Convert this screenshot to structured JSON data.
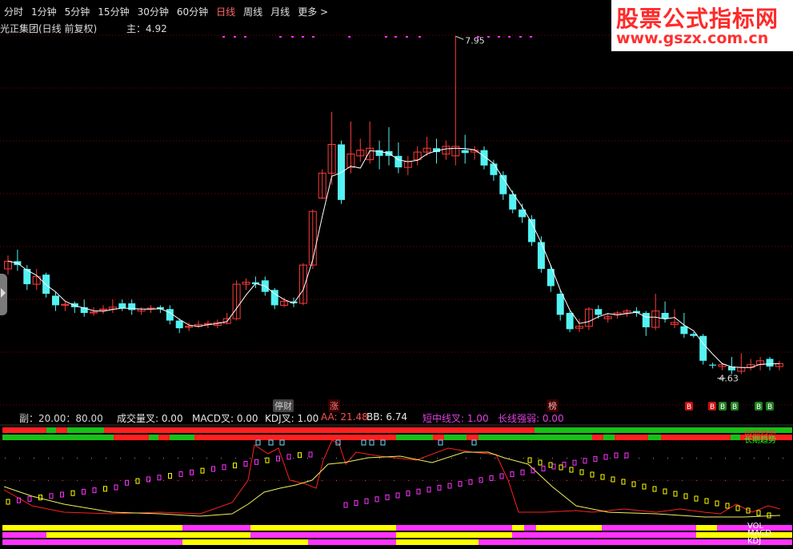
{
  "toolbar": {
    "tabs": [
      "分时",
      "1分钟",
      "5分钟",
      "15分钟",
      "30分钟",
      "60分钟",
      "日线",
      "周线",
      "月线",
      "更多 >"
    ],
    "active": "日线"
  },
  "stock": {
    "title": "光正集团(日线 前复权)",
    "main_label": "主：4.92"
  },
  "brand": {
    "title": "股票公式指标网",
    "url": "www.gszx.com.cn"
  },
  "annotations": {
    "high": "7.95",
    "low": "4.63"
  },
  "event_tags": [
    {
      "text": "停财",
      "color": "#cfcfcf",
      "bg": "#444"
    },
    {
      "text": "涨",
      "color": "#ff8080",
      "bg": "#3a0000"
    },
    {
      "text": "榜",
      "color": "#ffb0b0",
      "bg": "#3a0000"
    }
  ],
  "bottom_markers": [
    "B",
    "B",
    "B",
    "B",
    "B",
    "B"
  ],
  "indicator_bar": {
    "sub": "副：20.00：80.00",
    "vol_cross": "成交量叉: 0.00",
    "macd_cross": "MACD叉: 0.00",
    "kdj_cross": "KDJ叉: 1.00",
    "aa": "AA: 21.48",
    "bb": "BB: 6.74",
    "mid_cross": "短中线叉: 1.00",
    "long_strength": "长线强弱: 0.00"
  },
  "strip_labels": {
    "top1": "中期趋势",
    "top2": "长期趋势",
    "vol": "VOL",
    "macd": "MACD",
    "kdj": "KDJ"
  },
  "colors": {
    "up": "#ff3b3b",
    "down": "#54f2f2",
    "ma": "#ffffff",
    "grid": "#8a0000",
    "green": "#18c018",
    "red": "#ff2020",
    "yellow": "#ffff00",
    "magenta": "#ff33ff",
    "line_red": "#ff2020",
    "line_yellow": "#f0f060"
  },
  "chart_data": {
    "type": "candlestick",
    "candles": [
      [
        5.52,
        5.6,
        5.66,
        5.46
      ],
      [
        5.6,
        5.56,
        5.72,
        5.5
      ],
      [
        5.52,
        5.36,
        5.56,
        5.3
      ],
      [
        5.36,
        5.44,
        5.52,
        5.3
      ],
      [
        5.46,
        5.26,
        5.48,
        5.22
      ],
      [
        5.24,
        5.14,
        5.28,
        5.08
      ],
      [
        5.14,
        5.15,
        5.18,
        5.08
      ],
      [
        5.16,
        5.12,
        5.18,
        5.06
      ],
      [
        5.12,
        5.06,
        5.2,
        5.02
      ],
      [
        5.06,
        5.07,
        5.12,
        5.03
      ],
      [
        5.09,
        5.1,
        5.14,
        5.05
      ],
      [
        5.1,
        5.12,
        5.2,
        5.06
      ],
      [
        5.16,
        5.11,
        5.2,
        5.08
      ],
      [
        5.16,
        5.09,
        5.2,
        5.04
      ],
      [
        5.08,
        5.1,
        5.12,
        5.04
      ],
      [
        5.1,
        5.11,
        5.14,
        5.06
      ],
      [
        5.12,
        5.1,
        5.14,
        5.06
      ],
      [
        5.1,
        4.98,
        5.14,
        4.94
      ],
      [
        4.98,
        4.9,
        5.0,
        4.85
      ],
      [
        4.91,
        4.92,
        4.96,
        4.87
      ],
      [
        4.92,
        4.94,
        4.98,
        4.9
      ],
      [
        4.94,
        4.95,
        4.98,
        4.9
      ],
      [
        4.93,
        4.96,
        4.99,
        4.9
      ],
      [
        4.95,
        5.0,
        5.06,
        4.94
      ],
      [
        5.0,
        5.36,
        5.4,
        4.98
      ],
      [
        5.36,
        5.38,
        5.42,
        5.3
      ],
      [
        5.38,
        5.36,
        5.44,
        5.32
      ],
      [
        5.4,
        5.28,
        5.44,
        5.24
      ],
      [
        5.3,
        5.14,
        5.32,
        5.1
      ],
      [
        5.14,
        5.18,
        5.22,
        5.12
      ],
      [
        5.18,
        5.16,
        5.22,
        5.12
      ],
      [
        5.16,
        5.56,
        5.58,
        5.14
      ],
      [
        5.56,
        6.12,
        6.14,
        5.52
      ],
      [
        6.26,
        6.52,
        6.56,
        6.25
      ],
      [
        6.52,
        6.82,
        7.16,
        6.4
      ],
      [
        6.82,
        6.24,
        6.86,
        6.2
      ],
      [
        6.58,
        6.72,
        7.06,
        6.52
      ],
      [
        6.7,
        6.76,
        6.88,
        6.64
      ],
      [
        6.66,
        6.78,
        7.06,
        6.62
      ],
      [
        6.76,
        6.7,
        6.86,
        6.56
      ],
      [
        6.75,
        6.7,
        7.0,
        6.6
      ],
      [
        6.7,
        6.58,
        6.84,
        6.52
      ],
      [
        6.58,
        6.64,
        6.7,
        6.5
      ],
      [
        6.66,
        6.74,
        6.8,
        6.6
      ],
      [
        6.74,
        6.78,
        6.9,
        6.7
      ],
      [
        6.78,
        6.74,
        6.88,
        6.62
      ],
      [
        6.72,
        6.8,
        6.86,
        6.66
      ],
      [
        6.7,
        6.8,
        7.95,
        6.6
      ],
      [
        6.76,
        6.73,
        6.92,
        6.62
      ],
      [
        6.74,
        6.76,
        6.8,
        6.66
      ],
      [
        6.76,
        6.6,
        6.8,
        6.56
      ],
      [
        6.62,
        6.5,
        6.66,
        6.44
      ],
      [
        6.5,
        6.3,
        6.54,
        6.24
      ],
      [
        6.3,
        6.14,
        6.34,
        6.1
      ],
      [
        6.14,
        6.06,
        6.2,
        6.0
      ],
      [
        6.04,
        5.8,
        6.08,
        5.76
      ],
      [
        5.8,
        5.52,
        5.86,
        5.48
      ],
      [
        5.52,
        5.34,
        5.56,
        5.28
      ],
      [
        5.26,
        5.04,
        5.3,
        4.98
      ],
      [
        5.06,
        4.89,
        5.08,
        4.86
      ],
      [
        4.9,
        4.92,
        5.0,
        4.86
      ],
      [
        4.92,
        5.1,
        5.12,
        4.88
      ],
      [
        5.1,
        5.04,
        5.14,
        5.0
      ],
      [
        5.0,
        5.02,
        5.06,
        4.96
      ],
      [
        5.04,
        5.06,
        5.08,
        5.0
      ],
      [
        5.06,
        5.08,
        5.1,
        5.02
      ],
      [
        5.08,
        5.06,
        5.12,
        5.02
      ],
      [
        5.06,
        4.91,
        5.08,
        4.82
      ],
      [
        4.91,
        5.08,
        5.26,
        4.88
      ],
      [
        5.06,
        5.0,
        5.18,
        4.96
      ],
      [
        4.94,
        4.96,
        5.1,
        4.9
      ],
      [
        4.92,
        4.84,
        5.06,
        4.8
      ],
      [
        4.84,
        4.82,
        4.86,
        4.8
      ],
      [
        4.82,
        4.56,
        4.84,
        4.52
      ],
      [
        4.52,
        4.51,
        4.54,
        4.48
      ],
      [
        4.5,
        4.52,
        4.54,
        4.46
      ],
      [
        4.5,
        4.46,
        4.6,
        4.42
      ],
      [
        4.45,
        4.49,
        4.64,
        4.42
      ],
      [
        4.49,
        4.52,
        4.58,
        4.46
      ],
      [
        4.52,
        4.56,
        4.6,
        4.46
      ],
      [
        4.58,
        4.5,
        4.6,
        4.46
      ],
      [
        4.5,
        4.53,
        4.56,
        4.46
      ]
    ]
  }
}
